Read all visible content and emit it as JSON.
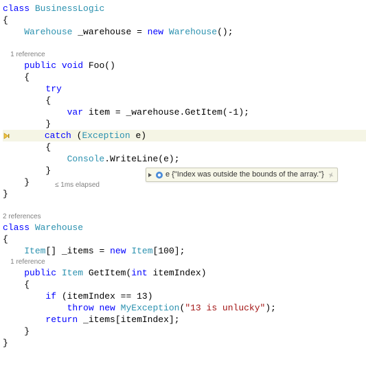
{
  "codelens": {
    "foo": "1 reference",
    "warehouse": "2 references",
    "getitem": "1 reference"
  },
  "kw": {
    "class": "class",
    "new": "new",
    "public": "public",
    "void": "void",
    "try": "try",
    "var": "var",
    "catch": "catch",
    "int": "int",
    "if": "if",
    "throw": "throw",
    "return": "return"
  },
  "type": {
    "BusinessLogic": "BusinessLogic",
    "Warehouse": "Warehouse",
    "Exception": "Exception",
    "Console": "Console",
    "Item": "Item",
    "MyException": "MyException"
  },
  "id": {
    "warehouse_field": "_warehouse",
    "Foo": "Foo",
    "item": "item",
    "GetItem": "GetItem",
    "e": "e",
    "WriteLine": "WriteLine",
    "items_field": "_items",
    "itemIndex": "itemIndex"
  },
  "lit": {
    "neg1": "-1",
    "hundred": "100",
    "thirteen": "13",
    "unlucky": "\"13 is unlucky\""
  },
  "debug": {
    "perf_tip": "≤ 1ms elapsed",
    "datatip_var": "e",
    "datatip_value": "{\"Index was outside the bounds of the array.\"}"
  },
  "punct": {
    "obrace": "{",
    "cbrace": "}",
    "oparen": "(",
    "cparen": ")",
    "semi": ";",
    "eq": " = ",
    "dot": ".",
    "obracket": "[",
    "cbracket": "]",
    "eqeq": " == ",
    "empty_parens": "()"
  },
  "space": {
    "s1": " ",
    "i1": "    ",
    "i2": "        ",
    "i3": "            ",
    "i4": "                "
  }
}
